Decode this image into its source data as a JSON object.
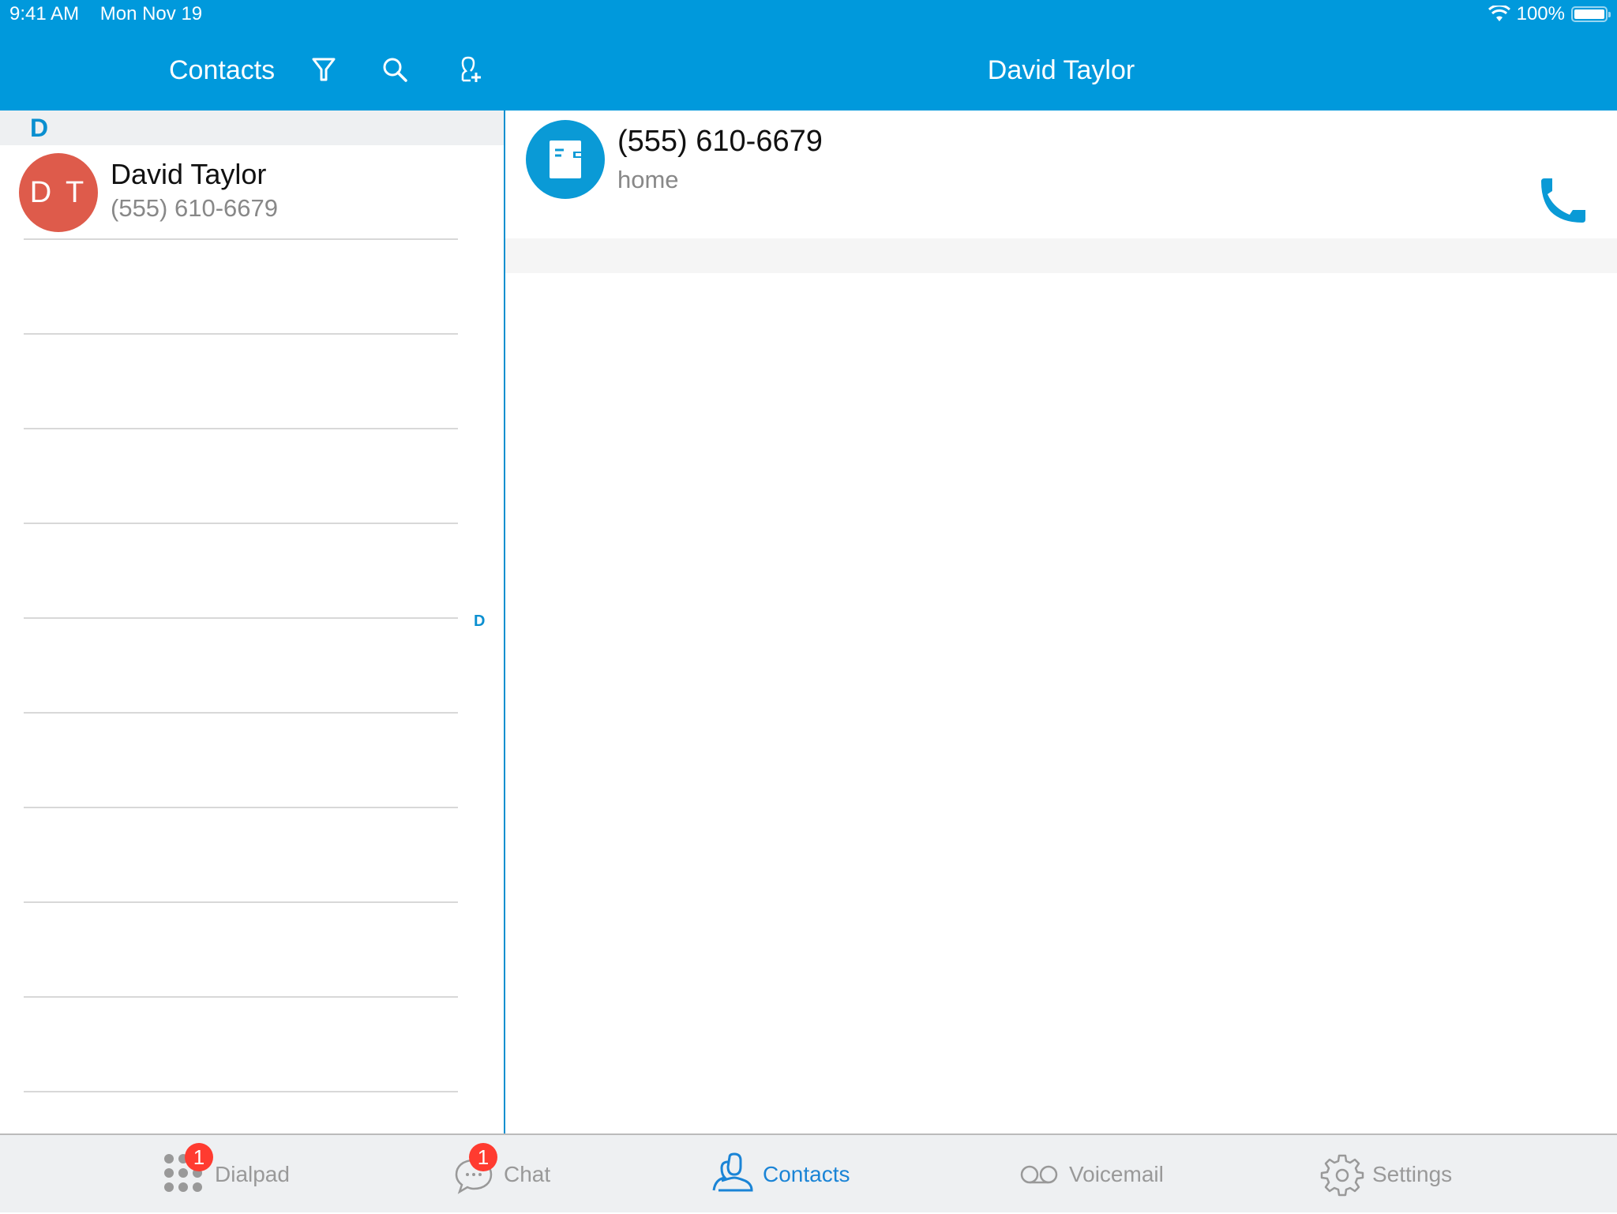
{
  "status_bar": {
    "time": "9:41 AM",
    "date": "Mon Nov 19",
    "battery": "100%",
    "battery_level": 1.0
  },
  "left_header": {
    "title": "Contacts",
    "icons": [
      "filter-icon",
      "search-icon",
      "add-contact-icon"
    ]
  },
  "right_header": {
    "title": "David Taylor"
  },
  "contacts": {
    "sections": [
      {
        "letter": "D",
        "items": [
          {
            "initials": "D T",
            "name": "David Taylor",
            "phone": "(555) 610-6679"
          }
        ]
      }
    ],
    "index_letters": [
      "D"
    ]
  },
  "detail": {
    "phones": [
      {
        "number": "(555) 610-6679",
        "label": "home",
        "icon": "address-book-icon",
        "action": "phone-call-icon"
      }
    ]
  },
  "tabbar": {
    "tabs": [
      {
        "label": "Dialpad",
        "badge": "1",
        "icon": "dialpad-icon",
        "active": false
      },
      {
        "label": "Chat",
        "badge": "1",
        "icon": "chat-icon",
        "active": false
      },
      {
        "label": "Contacts",
        "badge": null,
        "icon": "contacts-icon",
        "active": true
      },
      {
        "label": "Voicemail",
        "badge": null,
        "icon": "voicemail-icon",
        "active": false
      },
      {
        "label": "Settings",
        "badge": null,
        "icon": "gear-icon",
        "active": false
      }
    ]
  },
  "colors": {
    "accent": "#0099dc",
    "avatar": "#de5b4b",
    "badge": "#ff3b30",
    "active_tab": "#1a84d6"
  }
}
